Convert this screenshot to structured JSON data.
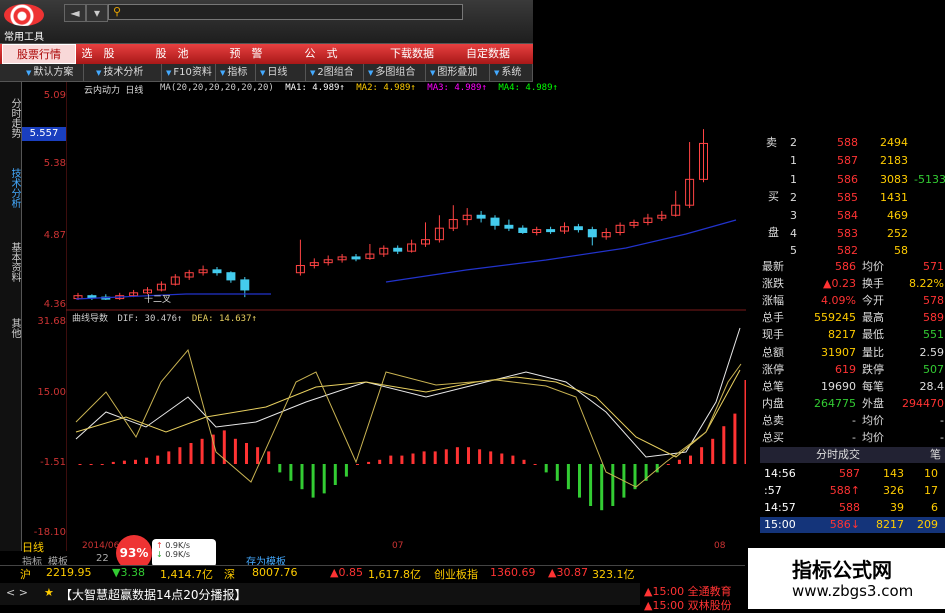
{
  "app": {
    "tool_label": "常用工具",
    "nav_back": "◄",
    "nav_fwd": "▾",
    "search_icon": "search-icon"
  },
  "menu": [
    "股票行情",
    "选　股",
    "股　池",
    "预　警",
    "公　式",
    "下载数据",
    "自定数据"
  ],
  "toolbar": [
    "默认方案",
    "技术分析",
    "F10资料",
    "指标",
    "日线",
    "2图组合",
    "多图组合",
    "图形叠加",
    "系统"
  ],
  "sidetabs": [
    "分时走势",
    "技术分析",
    "基本资料",
    "其他"
  ],
  "main_chart": {
    "title": "云内动力 日线",
    "ma_params": "MA(20,20,20,20,20,20)",
    "ma_values": [
      "MA1: 4.989↑",
      "MA2: 4.989↑",
      "MA3: 4.989↑",
      "MA4: 4.989↑"
    ],
    "yticks": [
      "5.09",
      "5.557",
      "5.38",
      "4.87",
      "4.36"
    ],
    "current_price": "5.557",
    "annotation": "十二叉"
  },
  "indicator": {
    "name": "曲线导数",
    "dif": "DIF: 30.476↑",
    "dea": "DEA: 14.637↑",
    "yticks": [
      "31.68",
      "15.00",
      "-1.51",
      "-18.10"
    ],
    "period": "日线",
    "x_labels": [
      "2014/06",
      "07",
      "08"
    ]
  },
  "right_panel": {
    "ask": [
      [
        "卖",
        "盘"
      ],
      [
        "2",
        "588",
        "2494"
      ],
      [
        "1",
        "587",
        "2183"
      ]
    ],
    "bid_label": [
      "买",
      "盘"
    ],
    "bids": [
      [
        "1",
        "586",
        "3083",
        "-5133"
      ],
      [
        "2",
        "585",
        "1431",
        ""
      ],
      [
        "3",
        "584",
        "469",
        ""
      ],
      [
        "4",
        "583",
        "252",
        ""
      ],
      [
        "5",
        "582",
        "58",
        ""
      ]
    ],
    "stats": [
      [
        "最新",
        "586",
        "均价",
        "571"
      ],
      [
        "涨跌",
        "▲0.23",
        "换手",
        "8.22%"
      ],
      [
        "涨幅",
        "4.09%",
        "今开",
        "578"
      ],
      [
        "总手",
        "559245",
        "最高",
        "589"
      ],
      [
        "现手",
        "8217",
        "最低",
        "551"
      ],
      [
        "总额",
        "31907",
        "量比",
        "2.59"
      ],
      [
        "涨停",
        "619",
        "跌停",
        "507"
      ],
      [
        "总笔",
        "19690",
        "每笔",
        "28.4"
      ],
      [
        "内盘",
        "264775",
        "外盘",
        "294470"
      ],
      [
        "总卖",
        "-",
        "均价",
        "-"
      ],
      [
        "总买",
        "-",
        "均价",
        "-"
      ]
    ],
    "tick_tab": "分时成交",
    "tick_tab2": "笔",
    "ticks": [
      [
        "14:56",
        "587",
        "143",
        "10"
      ],
      [
        ":57",
        "588↑",
        "326",
        "17"
      ],
      [
        "14:57",
        "588",
        "39",
        "6"
      ],
      [
        "15:00",
        "586↓",
        "8217",
        "209"
      ]
    ]
  },
  "bottom": {
    "tabs": [
      "指标",
      "模板",
      "22"
    ],
    "extra_tab": "存为模板",
    "cpu": "93%",
    "net_up": "0.9K/s",
    "net_down": "0.9K/s",
    "ticker": [
      {
        "label": "沪",
        "value": "2219.95"
      },
      {
        "label": "",
        "value": "▼3.38"
      },
      {
        "label": "",
        "value": "1,414.7亿"
      },
      {
        "label": "深",
        "value": "8007.76"
      },
      {
        "label": "",
        "value": "▲0.85"
      },
      {
        "label": "",
        "value": "1,617.8亿"
      },
      {
        "label": "创业板指",
        "value": "1360.69"
      },
      {
        "label": "",
        "value": "▲30.87"
      },
      {
        "label": "",
        "value": "323.1亿"
      }
    ],
    "news": "【大智慧超赢数据14点20分播报】",
    "news_right1": "▲15:00 全通教育",
    "news_right2": "▲15:00 双林股份"
  },
  "watermark": {
    "line1": "指标公式网",
    "line2": "www.zbgs3.com"
  },
  "colors": {
    "up": "#ff3333",
    "down": "#33cc33",
    "ma": "#2233cc",
    "candle_up": "#ff4444",
    "candle_down": "#44ccee",
    "dif": "#e8e8e8",
    "dea": "#e8d060"
  }
}
